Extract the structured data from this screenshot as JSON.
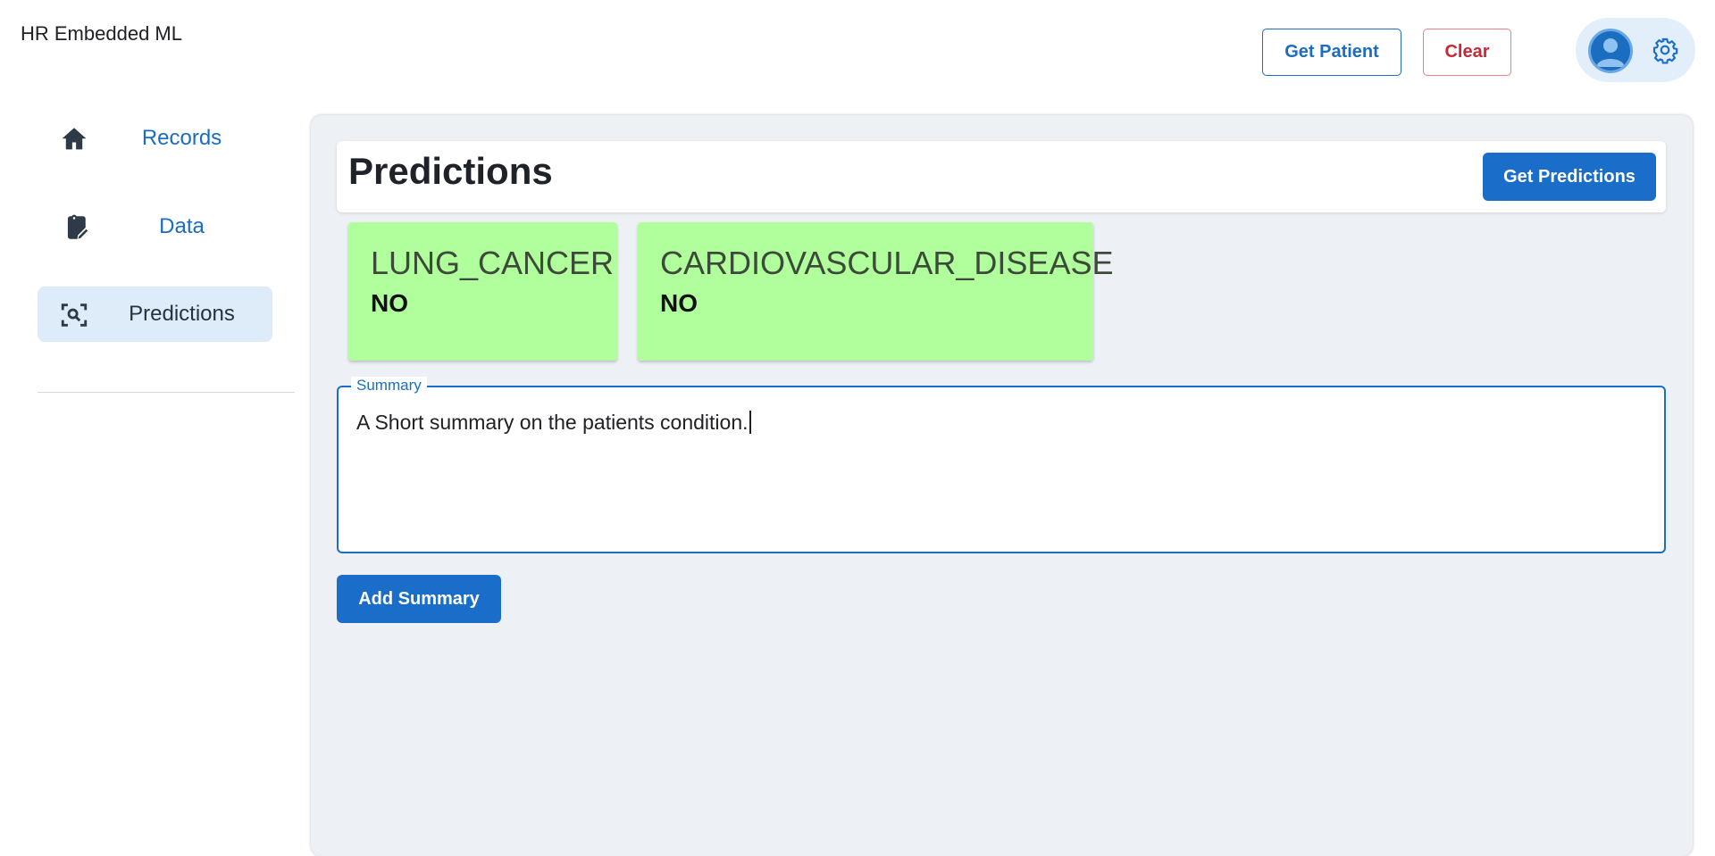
{
  "app": {
    "title": "HR Embedded ML"
  },
  "header": {
    "get_patient_label": "Get Patient",
    "clear_label": "Clear"
  },
  "icons": {
    "avatar": "account-circle-icon",
    "settings": "gear-icon",
    "home": "home-icon",
    "data": "clipboard-edit-icon",
    "predictions": "scan-search-icon"
  },
  "sidebar": {
    "items": [
      {
        "label": "Records",
        "active": false
      },
      {
        "label": "Data",
        "active": false
      },
      {
        "label": "Predictions",
        "active": true
      }
    ]
  },
  "main": {
    "title": "Predictions",
    "get_predictions_label": "Get Predictions",
    "predictions": [
      {
        "name": "LUNG_CANCER",
        "value": "NO"
      },
      {
        "name": "CARDIOVASCULAR_DISEASE",
        "value": "NO"
      }
    ],
    "summary": {
      "label": "Summary",
      "value": "A Short summary on the patients condition."
    },
    "add_summary_label": "Add Summary"
  },
  "colors": {
    "primary": "#1a6dc9",
    "danger": "#c62a36",
    "card_negative": "#b0fe9c",
    "panel_bg": "#edf0f4",
    "nav_active_bg": "#deebf8"
  }
}
